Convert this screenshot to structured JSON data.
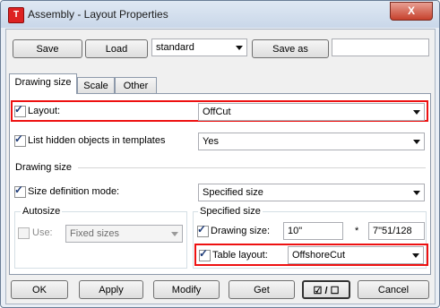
{
  "window": {
    "title": "Assembly - Layout Properties",
    "close_glyph": "X"
  },
  "toolbar": {
    "save_label": "Save",
    "load_label": "Load",
    "preset_value": "standard",
    "save_as_label": "Save as",
    "save_as_name": ""
  },
  "tabs": [
    {
      "label": "Drawing size"
    },
    {
      "label": "Scale"
    },
    {
      "label": "Other"
    }
  ],
  "fields": {
    "layout": {
      "label": "Layout:",
      "value": "OffCut",
      "checked": true
    },
    "list_hidden": {
      "label": "List hidden objects in templates",
      "value": "Yes",
      "checked": true
    },
    "section_drawing_size": "Drawing size",
    "size_definition": {
      "label": "Size definition mode:",
      "value": "Specified size",
      "checked": true
    },
    "autosize": {
      "title": "Autosize",
      "use_label": "Use:",
      "use_checked": false,
      "mode_value": "Fixed sizes"
    },
    "specified_size": {
      "title": "Specified size",
      "drawing_size_label": "Drawing size:",
      "drawing_size_checked": true,
      "width": "10\"",
      "times": "*",
      "height": "7\"51/128"
    },
    "table_layout": {
      "label": "Table layout:",
      "value": "OffshoreCut",
      "checked": true
    }
  },
  "buttons": {
    "ok": "OK",
    "apply": "Apply",
    "modify": "Modify",
    "get": "Get",
    "toggle": "☑ / ☐",
    "cancel": "Cancel"
  },
  "icons": {
    "app": "tekla-app-icon",
    "checkmark": "✓"
  },
  "colors": {
    "highlight_border": "#ee1111",
    "close_button": "#c6412c"
  }
}
